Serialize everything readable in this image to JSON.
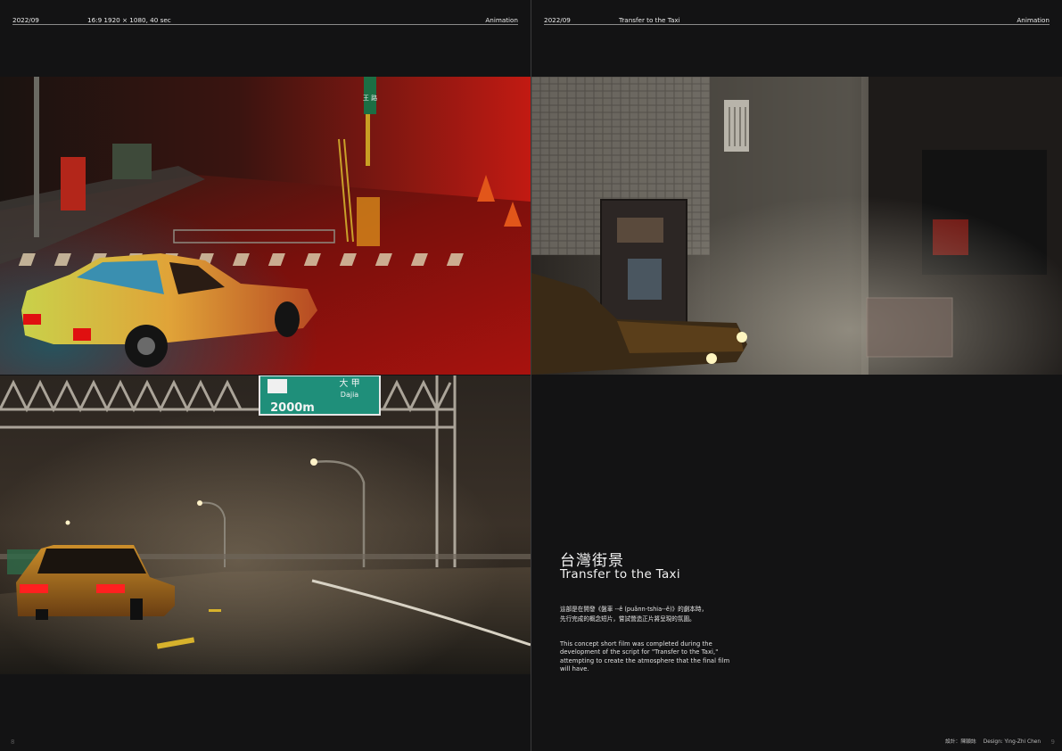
{
  "left_page": {
    "header": {
      "date": "2022/09",
      "spec": "16:9 1920 × 1080, 40 sec",
      "category": "Animation"
    },
    "images": {
      "street_scene": {
        "sign_text": "王 路"
      },
      "highway_scene": {
        "sign_distance": "2000m",
        "sign_name_zh": "大 甲",
        "sign_name_en": "Dajia"
      }
    },
    "folio": "8"
  },
  "right_page": {
    "header": {
      "date": "2022/09",
      "title": "Transfer to the Taxi",
      "category": "Animation"
    },
    "title_zh": "台灣街景",
    "title_en": "Transfer to the Taxi",
    "body_zh_line1": "這部是在開發《盤車 --ê (puânn-tshia--ê)》的劇本時，",
    "body_zh_line2": "先行完成的概念短片，嘗試營造正片將呈現的氛圍。",
    "body_en": "This concept short film was completed during the development of the script for \"Transfer to the Taxi,\" attempting to create the atmosphere that the final film will have.",
    "credit_zh": "設計：陳穎誌",
    "credit_en": "Design: Ying-Zhi Chen",
    "folio": "9"
  },
  "colors": {
    "background": "#131314",
    "text": "#e9e9e9",
    "taxi_yellow": "#d9a640",
    "street_red": "#b81412",
    "sign_green": "#1f8f7a"
  }
}
